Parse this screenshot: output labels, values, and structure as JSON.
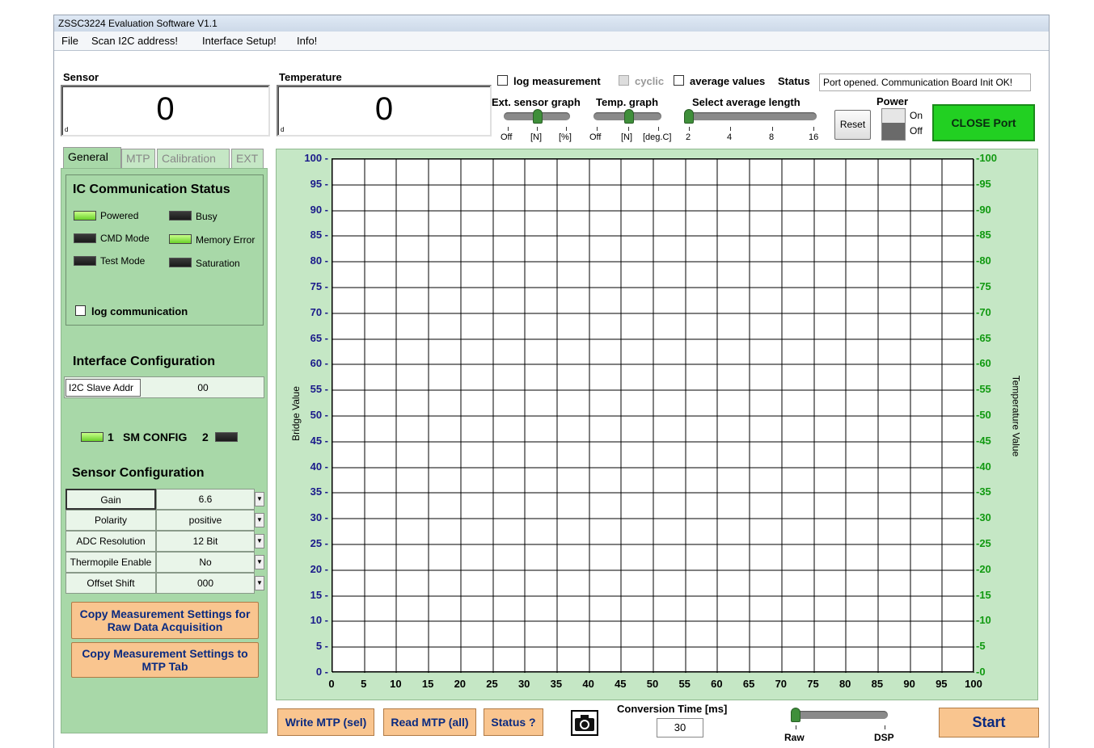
{
  "window": {
    "title": "ZSSC3224 Evaluation Software V1.1"
  },
  "menu": [
    "File",
    "Scan I2C address!",
    "Interface Setup!",
    "Info!"
  ],
  "sensor": {
    "label": "Sensor",
    "value": "0",
    "marker": "d"
  },
  "temperature": {
    "label": "Temperature",
    "value": "0",
    "marker": "d"
  },
  "options": {
    "log_measurement": "log measurement",
    "cyclic": "cyclic",
    "average_values": "average values",
    "status_label": "Status",
    "status_text": "Port opened. Communication Board Init OK!"
  },
  "ext_sensor_graph": {
    "label": "Ext. sensor graph",
    "ticks": [
      "Off",
      "[N]",
      "[%]"
    ],
    "selected": "[N]"
  },
  "temp_graph": {
    "label": "Temp. graph",
    "ticks": [
      "Off",
      "[N]",
      "[deg.C]"
    ],
    "selected": "[N]"
  },
  "average_length": {
    "label": "Select average length",
    "ticks": [
      "2",
      "4",
      "8",
      "16"
    ],
    "selected": "2"
  },
  "power": {
    "label": "Power",
    "on": "On",
    "off": "Off",
    "reset": "Reset"
  },
  "close_port": "CLOSE Port",
  "tabs": [
    "General",
    "MTP",
    "Calibration",
    "EXT"
  ],
  "ic_status": {
    "title": "IC Communication Status",
    "leds": [
      {
        "label": "Powered",
        "state": "on"
      },
      {
        "label": "Busy",
        "state": "off"
      },
      {
        "label": "CMD Mode",
        "state": "off"
      },
      {
        "label": "Memory Error",
        "state": "on"
      },
      {
        "label": "Test Mode",
        "state": "off"
      },
      {
        "label": "Saturation",
        "state": "off"
      }
    ],
    "log_communication": "log communication"
  },
  "interface_config": {
    "title": "Interface Configuration",
    "slave_addr_label": "I2C Slave Addr",
    "slave_addr_value": "00",
    "sm_left": "1",
    "sm_label": "SM CONFIG",
    "sm_right": "2"
  },
  "sensor_config": {
    "title": "Sensor Configuration",
    "rows": [
      {
        "name": "Gain",
        "value": "6.6"
      },
      {
        "name": "Polarity",
        "value": "positive"
      },
      {
        "name": "ADC Resolution",
        "value": "12 Bit"
      },
      {
        "name": "Thermopile Enable",
        "value": "No"
      },
      {
        "name": "Offset Shift",
        "value": "000"
      }
    ],
    "copy_raw": "Copy Measurement Settings for Raw Data Acquisition",
    "copy_mtp": "Copy Measurement Settings to MTP Tab"
  },
  "graph": {
    "left_axis_label": "Bridge Value",
    "right_axis_label": "Temperature Value",
    "y_ticks": [
      "100",
      "95",
      "90",
      "85",
      "80",
      "75",
      "70",
      "65",
      "60",
      "55",
      "50",
      "45",
      "40",
      "35",
      "30",
      "25",
      "20",
      "15",
      "10",
      "5",
      "0"
    ],
    "x_ticks": [
      "0",
      "5",
      "10",
      "15",
      "20",
      "25",
      "30",
      "35",
      "40",
      "45",
      "50",
      "55",
      "60",
      "65",
      "70",
      "75",
      "80",
      "85",
      "90",
      "95",
      "100"
    ]
  },
  "bottom": {
    "write_mtp": "Write MTP (sel)",
    "read_mtp": "Read MTP (all)",
    "status": "Status ?",
    "conversion_label": "Conversion Time [ms]",
    "conversion_value": "30",
    "raw": "Raw",
    "dsp": "DSP",
    "start": "Start"
  },
  "colors": {
    "panel_green": "#a8d8a8",
    "button_orange": "#f9c58f",
    "close_port_green": "#22d022"
  }
}
